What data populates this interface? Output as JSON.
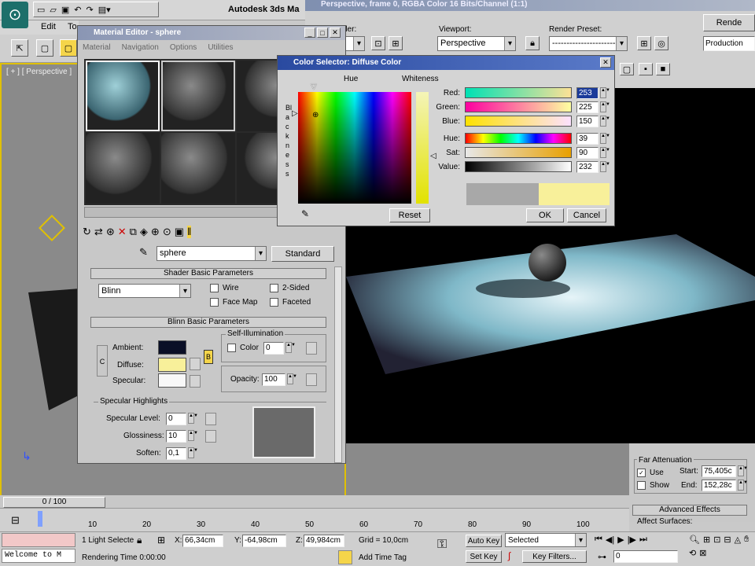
{
  "app": {
    "title": "Autodesk 3ds Ma",
    "menu_items": [
      "Edit",
      "To"
    ]
  },
  "render_frame": {
    "title": "Perspective, frame 0, RGBA Color 16 Bits/Channel (1:1)",
    "area_label": "der:",
    "viewport_label": "Viewport:",
    "viewport_value": "Perspective",
    "preset_label": "Render Preset:",
    "preset_value": "-------------------------",
    "render_button": "Rende",
    "production": "Production"
  },
  "viewport": {
    "label": "[ + ] [ Perspective ]"
  },
  "material_editor": {
    "title": "Material Editor - sphere",
    "menus": [
      "Material",
      "Navigation",
      "Options",
      "Utilities"
    ],
    "material_name": "sphere",
    "material_type": "Standard",
    "shader_rollout": "Shader Basic Parameters",
    "shader_value": "Blinn",
    "wire": "Wire",
    "two_sided": "2-Sided",
    "face_map": "Face Map",
    "faceted": "Faceted",
    "blinn_rollout": "Blinn Basic Parameters",
    "self_illum": "Self-Illumination",
    "color_label": "Color",
    "color_value": "0",
    "ambient": "Ambient:",
    "diffuse": "Diffuse:",
    "specular": "Specular:",
    "lock": "C",
    "map_b": "B",
    "opacity_label": "Opacity:",
    "opacity_value": "100",
    "spec_highlights": "Specular Highlights",
    "spec_level": "Specular Level:",
    "spec_level_value": "0",
    "glossiness": "Glossiness:",
    "glossiness_value": "10",
    "soften": "Soften:",
    "soften_value": "0,1"
  },
  "color_selector": {
    "title": "Color Selector: Diffuse Color",
    "hue_label": "Hue",
    "whiteness_label": "Whiteness",
    "blackness_label": "Blackness",
    "channels": [
      {
        "name": "Red:",
        "value": "253"
      },
      {
        "name": "Green:",
        "value": "225"
      },
      {
        "name": "Blue:",
        "value": "150"
      },
      {
        "name": "Hue:",
        "value": "39"
      },
      {
        "name": "Sat:",
        "value": "90"
      },
      {
        "name": "Value:",
        "value": "232"
      }
    ],
    "reset": "Reset",
    "ok": "OK",
    "cancel": "Cancel",
    "old_color": "#a8a8a8",
    "new_color": "#f8f09a"
  },
  "attenuation": {
    "title": "Far Attenuation",
    "use": "Use",
    "show": "Show",
    "start_label": "Start:",
    "start_value": "75,405c",
    "end_label": "End:",
    "end_value": "152,28c",
    "advanced": "Advanced Effects",
    "affect": "Affect Surfaces:"
  },
  "timeline": {
    "slider": "0 / 100",
    "ticks": [
      "10",
      "20",
      "30",
      "40",
      "50",
      "60",
      "70",
      "80",
      "90",
      "100"
    ]
  },
  "status": {
    "maxscript": "Welcome to M",
    "selection": "1 Light Selecte",
    "x_label": "X:",
    "x_value": "66,34cm",
    "y_label": "Y:",
    "y_value": "-64,98cm",
    "z_label": "Z:",
    "z_value": "49,984cm",
    "grid": "Grid = 10,0cm",
    "rendering_time": "Rendering Time 0:00:00",
    "add_time_tag": "Add Time Tag",
    "auto_key": "Auto Key",
    "set_key": "Set Key",
    "selected": "Selected",
    "key_filters": "Key Filters...",
    "frame": "0"
  }
}
